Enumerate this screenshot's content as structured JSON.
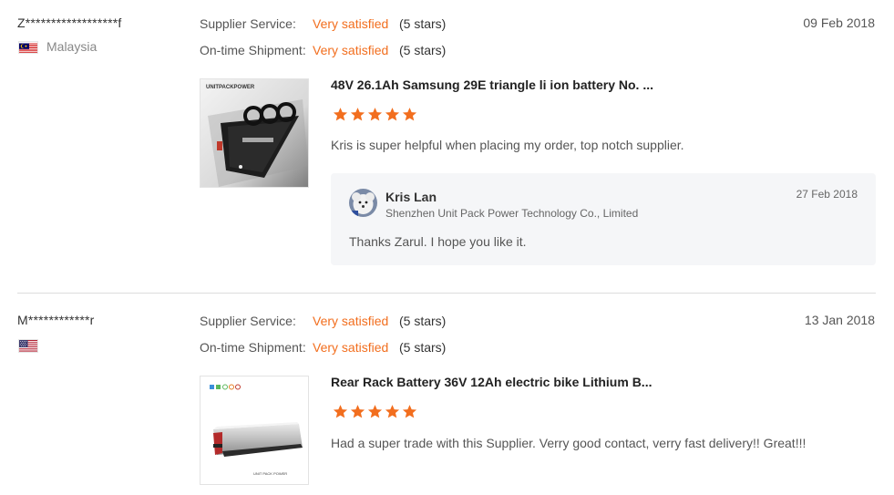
{
  "colors": {
    "accent": "#f26e1e",
    "divider": "#dddddd",
    "reply_bg": "#f5f6f8",
    "star": "#f26e1e"
  },
  "reviews": [
    {
      "buyer": "Z******************f",
      "country": "Malaysia",
      "flag_icon": "malaysia-flag-icon",
      "date": "09 Feb 2018",
      "ratings": [
        {
          "label": "Supplier Service:",
          "value": "Very satisfied",
          "stars_text": "(5 stars)"
        },
        {
          "label": "On-time Shipment:",
          "value": "Very satisfied",
          "stars_text": "(5 stars)"
        }
      ],
      "product": {
        "title": "48V 26.1Ah Samsung 29E triangle li ion battery No. ...",
        "image_brand_text": "UNITPACKPOWER",
        "stars": 5
      },
      "comment": "Kris is super helpful when placing my order, top notch supplier.",
      "reply": {
        "name": "Kris Lan",
        "company": "Shenzhen Unit Pack Power Technology Co., Limited",
        "date": "27 Feb 2018",
        "text": "Thanks Zarul. I hope you like it."
      }
    },
    {
      "buyer": "M************r",
      "country": "",
      "flag_icon": "usa-flag-icon",
      "date": "13 Jan 2018",
      "ratings": [
        {
          "label": "Supplier Service:",
          "value": "Very satisfied",
          "stars_text": "(5 stars)"
        },
        {
          "label": "On-time Shipment:",
          "value": "Very satisfied",
          "stars_text": "(5 stars)"
        }
      ],
      "product": {
        "title": "Rear Rack Battery 36V 12Ah electric bike Lithium B...",
        "image_brand_text": "UNIT PACK POWER",
        "stars": 5
      },
      "comment": "Had a super trade with this Supplier. Verry good contact, verry fast delivery!! Great!!!"
    }
  ]
}
